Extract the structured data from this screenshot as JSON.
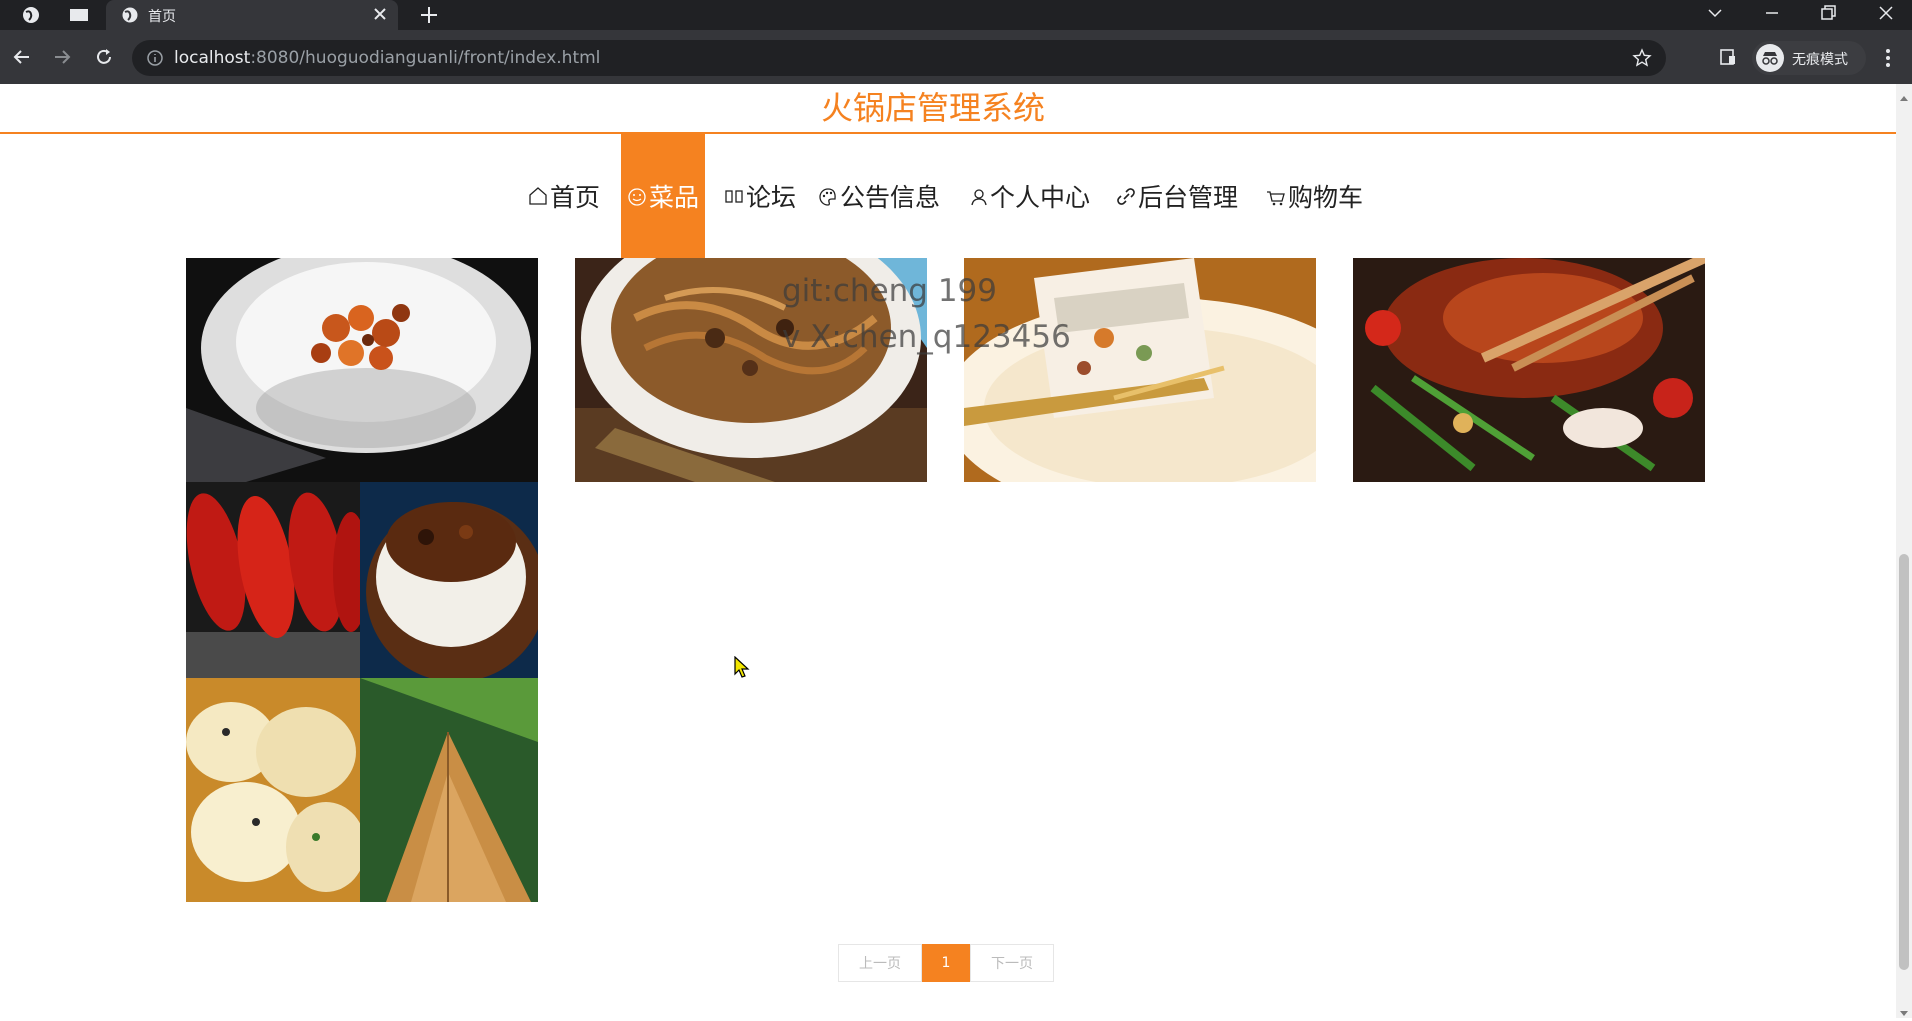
{
  "browser": {
    "tab_title": "首页",
    "url_host": "localhost",
    "url_rest": ":8080/huoguodianguanli/front/index.html",
    "incognito_label": "无痕模式"
  },
  "site": {
    "title": "火锅店管理系统",
    "accent_color": "#f58220"
  },
  "nav": {
    "items": [
      {
        "label": "首页",
        "icon": "home-icon"
      },
      {
        "label": "菜品",
        "icon": "smile-icon",
        "active": true
      },
      {
        "label": "论坛",
        "icon": "forum-icon"
      },
      {
        "label": "公告信息",
        "icon": "palette-icon"
      },
      {
        "label": "个人中心",
        "icon": "user-icon"
      },
      {
        "label": "后台管理",
        "icon": "link-icon"
      },
      {
        "label": "购物车",
        "icon": "cart-icon"
      }
    ]
  },
  "watermark": {
    "line1": "git:cheng 199",
    "line2": "v X:chen_q123456"
  },
  "dishes": [
    {
      "depicts": "spicy chicken dish in white bowl"
    },
    {
      "depicts": "stir-fried noodles with beef"
    },
    {
      "depicts": "slice of layered cake with fork"
    },
    {
      "depicts": "roasted meat with vegetables"
    },
    {
      "depicts": "collage of sausages, rice bowl, dumplings and zongzi"
    }
  ],
  "pagination": {
    "prev": "上一页",
    "current": "1",
    "next": "下一页"
  }
}
